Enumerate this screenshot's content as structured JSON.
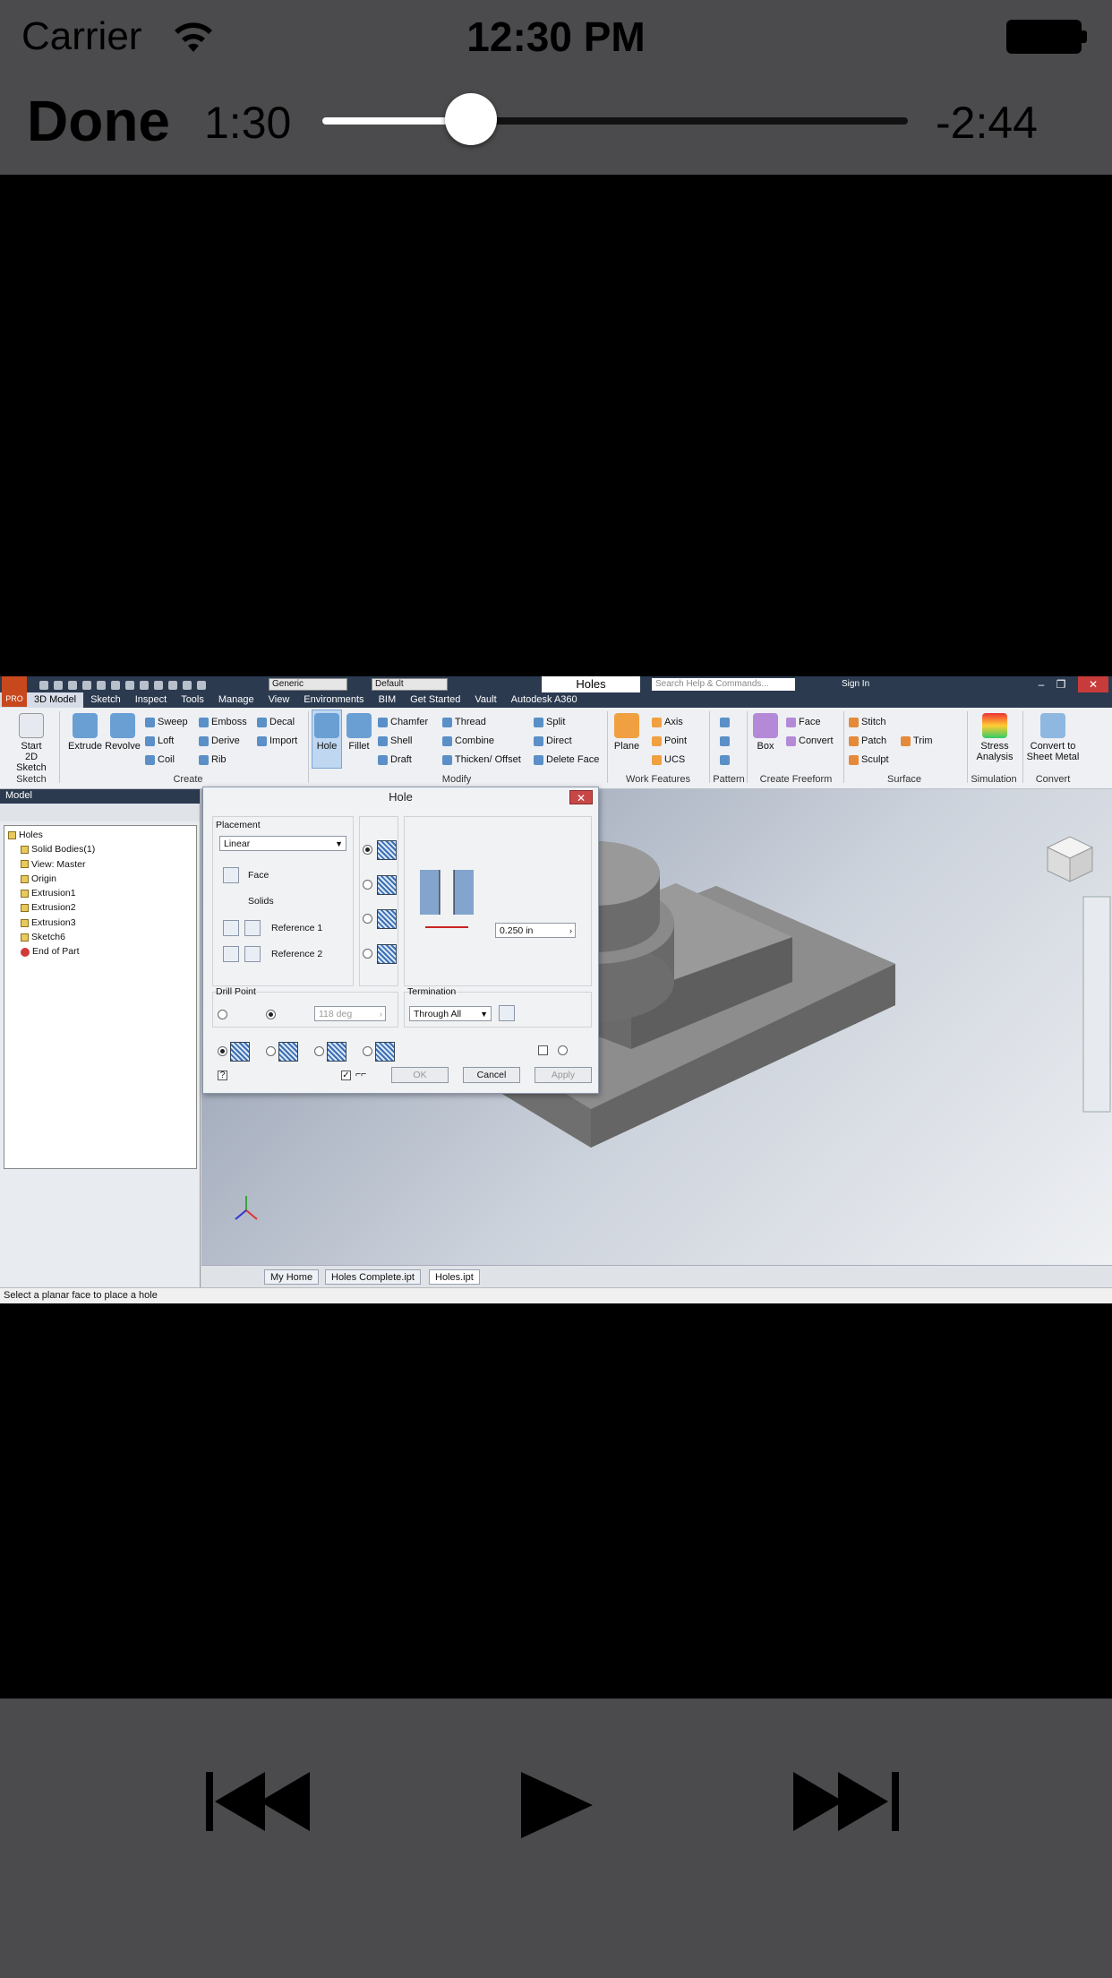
{
  "status_bar": {
    "carrier": "Carrier",
    "time": "12:30 PM"
  },
  "player": {
    "done_label": "Done",
    "elapsed": "1:30",
    "remaining": "-2:44",
    "progress_fraction": 0.254
  },
  "video": {
    "window_title": "Holes",
    "search_placeholder": "Search Help & Commands...",
    "sign_in": "Sign In",
    "app_badge": "PRO",
    "qat_combo_material": "Generic",
    "qat_combo_appearance": "Default",
    "menu_tabs": [
      "3D Model",
      "Sketch",
      "Inspect",
      "Tools",
      "Manage",
      "View",
      "Environments",
      "BIM",
      "Get Started",
      "Vault",
      "Autodesk A360"
    ],
    "active_menu_tab": "3D Model",
    "ribbon": {
      "sketch": {
        "start": "Start",
        "start2": "2D Sketch",
        "group": "Sketch"
      },
      "create": {
        "extrude": "Extrude",
        "revolve": "Revolve",
        "sweep": "Sweep",
        "emboss": "Emboss",
        "decal": "Decal",
        "loft": "Loft",
        "derive": "Derive",
        "import": "Import",
        "coil": "Coil",
        "rib": "Rib",
        "group": "Create"
      },
      "modify": {
        "hole": "Hole",
        "fillet": "Fillet",
        "chamfer": "Chamfer",
        "thread": "Thread",
        "split": "Split",
        "shell": "Shell",
        "combine": "Combine",
        "direct": "Direct",
        "draft": "Draft",
        "thicken": "Thicken/ Offset",
        "delete_face": "Delete Face",
        "group": "Modify"
      },
      "work_features": {
        "plane": "Plane",
        "axis": "Axis",
        "point": "Point",
        "ucs": "UCS",
        "group": "Work Features"
      },
      "pattern": {
        "group": "Pattern"
      },
      "freeform": {
        "box": "Box",
        "face": "Face",
        "convert": "Convert",
        "group": "Create Freeform"
      },
      "surface": {
        "stitch": "Stitch",
        "patch": "Patch",
        "trim": "Trim",
        "sculpt": "Sculpt",
        "group": "Surface"
      },
      "simulation": {
        "stress": "Stress",
        "analysis": "Analysis",
        "group": "Simulation"
      },
      "convert": {
        "line1": "Convert to",
        "line2": "Sheet Metal",
        "group": "Convert"
      }
    },
    "browser": {
      "title": "Model",
      "tree": [
        "Holes",
        "Solid Bodies(1)",
        "View: Master",
        "Origin",
        "Extrusion1",
        "Extrusion2",
        "Extrusion3",
        "Sketch6",
        "End of Part"
      ]
    },
    "dialog": {
      "title": "Hole",
      "placement_label": "Placement",
      "placement_value": "Linear",
      "face_label": "Face",
      "solids_label": "Solids",
      "reference1_label": "Reference 1",
      "reference2_label": "Reference 2",
      "dimension_value": "0.250 in",
      "drill_point_label": "Drill Point",
      "drill_angle": "118 deg",
      "termination_label": "Termination",
      "termination_value": "Through All",
      "ok_label": "OK",
      "cancel_label": "Cancel",
      "apply_label": "Apply"
    },
    "doc_tabs": [
      "My Home",
      "Holes Complete.ipt",
      "Holes.ipt"
    ],
    "active_doc_tab": "Holes.ipt",
    "status_message": "Select a planar face to place a hole"
  },
  "colors": {
    "bar_background": "#4b4b4d",
    "video_background": "#000000"
  }
}
